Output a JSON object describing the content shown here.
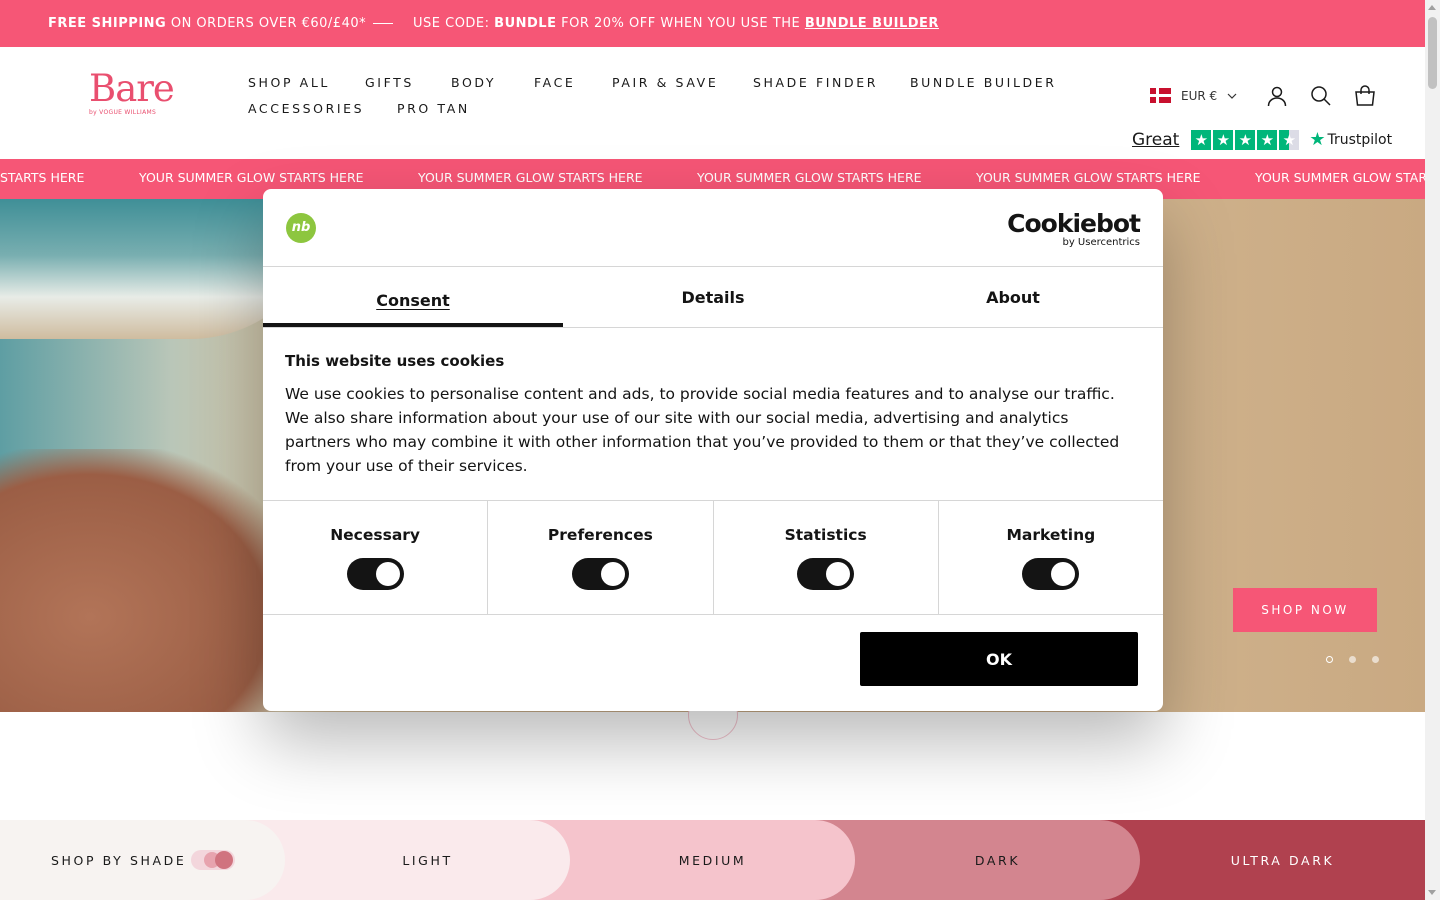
{
  "announcement": {
    "shipping_bold": "FREE SHIPPING",
    "shipping_rest": "ON ORDERS OVER €60/£40*",
    "code_prefix": "USE CODE:",
    "code": "BUNDLE",
    "code_rest": "FOR 20% OFF WHEN YOU USE THE",
    "link": "BUNDLE BUILDER"
  },
  "logo": {
    "word": "Bare",
    "sub": "by VOGUE WILLIAMS"
  },
  "nav": {
    "items": [
      "SHOP ALL",
      "GIFTS",
      "BODY",
      "FACE",
      "PAIR & SAVE",
      "SHADE FINDER",
      "BUNDLE BUILDER",
      "ACCESSORIES",
      "PRO TAN"
    ]
  },
  "currency": {
    "label": "EUR €"
  },
  "trustpilot": {
    "rating_word": "Great",
    "brand": "Trustpilot",
    "stars": 4.5
  },
  "marquee": {
    "text": "YOUR SUMMER GLOW STARTS HERE",
    "text_partial": "STARTS HERE"
  },
  "hero": {
    "cta": "SHOP NOW",
    "slides": 3,
    "active_slide": 1
  },
  "shade_bar": {
    "label": "SHOP BY SHADE",
    "shades": [
      "LIGHT",
      "MEDIUM",
      "DARK",
      "ULTRA DARK"
    ]
  },
  "cookie": {
    "logo_text": "Cookiebot",
    "logo_by": "by Usercentrics",
    "brand_mark": "nb",
    "tabs": [
      "Consent",
      "Details",
      "About"
    ],
    "active_tab": "Consent",
    "title": "This website uses cookies",
    "body": "We use cookies to personalise content and ads, to provide social media features and to analyse our traffic. We also share information about your use of our site with our social media, advertising and analytics partners who may combine it with other information that you’ve provided to them or that they’ve collected from your use of their services.",
    "toggles": [
      {
        "label": "Necessary",
        "checked": true
      },
      {
        "label": "Preferences",
        "checked": true
      },
      {
        "label": "Statistics",
        "checked": true
      },
      {
        "label": "Marketing",
        "checked": true
      }
    ],
    "ok_label": "OK"
  },
  "colors": {
    "brand_pink": "#f65676",
    "dark": "#141414"
  }
}
